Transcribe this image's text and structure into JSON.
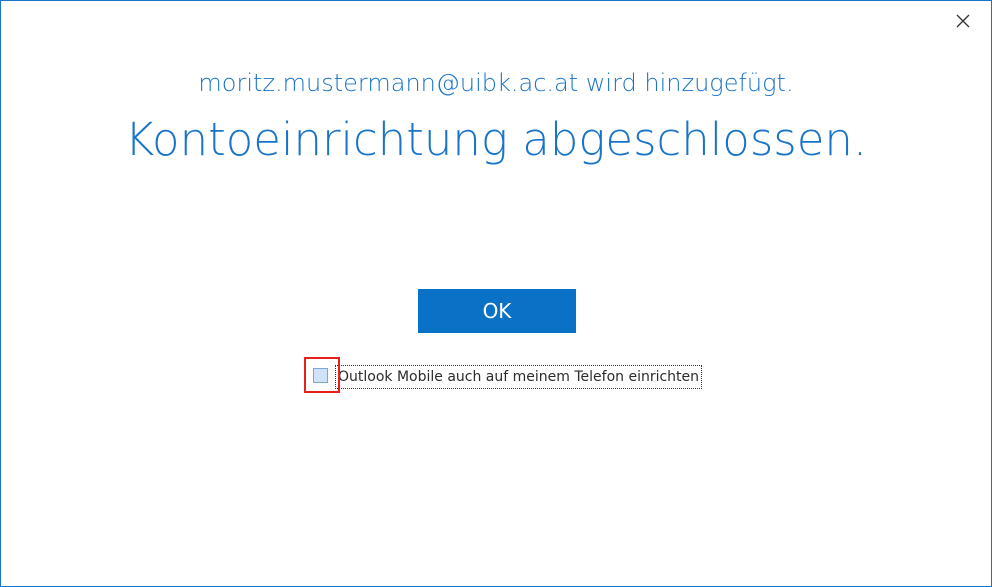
{
  "dialog": {
    "subtitle": "moritz.mustermann@uibk.ac.at wird hinzugefügt.",
    "title": "Kontoeinrichtung abgeschlossen.",
    "ok_label": "OK",
    "checkbox": {
      "label": "Outlook Mobile auch auf meinem Telefon einrichten",
      "checked": false
    },
    "close_icon": "close-icon"
  },
  "colors": {
    "accent": "#1874c8",
    "button": "#0a72c6",
    "highlight": "#e8201c",
    "window_border": "#1a73c8"
  }
}
